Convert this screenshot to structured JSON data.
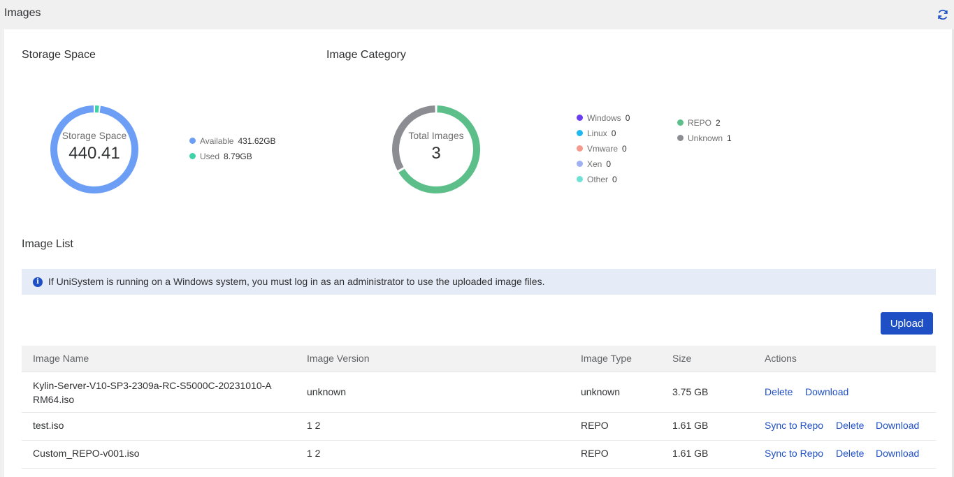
{
  "header": {
    "title": "Images",
    "refresh_icon": "refresh-icon"
  },
  "storage": {
    "title": "Storage Space",
    "center_caption": "Storage Space",
    "center_value": "440.41",
    "legend": [
      {
        "label": "Available",
        "value": "431.62GB",
        "color": "#6d9ef5"
      },
      {
        "label": "Used",
        "value": "8.79GB",
        "color": "#3fd1a8"
      }
    ]
  },
  "category": {
    "title": "Image Category",
    "center_caption": "Total Images",
    "center_value": "3",
    "legend": [
      {
        "label": "Windows",
        "value": "0",
        "color": "#6a3ef0"
      },
      {
        "label": "Linux",
        "value": "0",
        "color": "#1fb7f0"
      },
      {
        "label": "Vmware",
        "value": "0",
        "color": "#f59a8c"
      },
      {
        "label": "Xen",
        "value": "0",
        "color": "#9fb1f2"
      },
      {
        "label": "Other",
        "value": "0",
        "color": "#6fe0d6"
      },
      {
        "label": "REPO",
        "value": "2",
        "color": "#5cbf8a"
      },
      {
        "label": "Unknown",
        "value": "1",
        "color": "#8b8d93"
      }
    ]
  },
  "list": {
    "title": "Image List",
    "info": "If UniSystem is running on a Windows system, you must log in as an administrator to use the uploaded image files.",
    "upload_label": "Upload",
    "columns": [
      "Image Name",
      "Image Version",
      "Image Type",
      "Size",
      "Actions"
    ],
    "rows": [
      {
        "name_line1": "Kylin-Server-V10-SP3-2309a-RC-S5000C-20231010-A",
        "name_line2": "RM64.iso",
        "version": "unknown",
        "type": "unknown",
        "size": "3.75 GB",
        "actions": [
          "Delete",
          "Download"
        ]
      },
      {
        "name_line1": "test.iso",
        "version": "1 2",
        "type": "REPO",
        "size": "1.61 GB",
        "actions": [
          "Sync to Repo",
          "Delete",
          "Download"
        ]
      },
      {
        "name_line1": "Custom_REPO-v001.iso",
        "version": "1 2",
        "type": "REPO",
        "size": "1.61 GB",
        "actions": [
          "Sync to Repo",
          "Delete",
          "Download"
        ]
      }
    ]
  },
  "colors": {
    "accent": "#1e4fc4",
    "banner": "#e6ecf7",
    "header_bg": "#f2f2f2"
  }
}
